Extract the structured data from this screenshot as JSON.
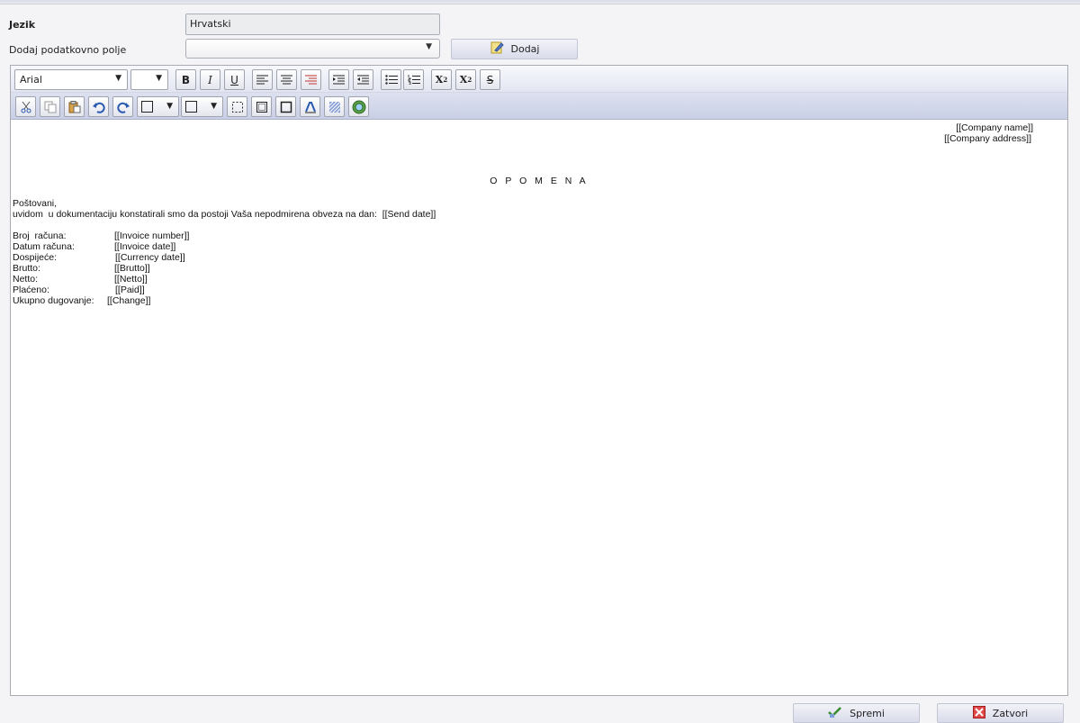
{
  "form": {
    "language_label": "Jezik",
    "language_value": "Hrvatski",
    "add_field_label": "Dodaj podatkovno polje",
    "add_field_selected": "",
    "add_button": "Dodaj"
  },
  "toolbar": {
    "font_family": "Arial",
    "font_size": "",
    "bold": "B",
    "italic": "I",
    "underline": "U"
  },
  "document": {
    "company_name": "[[Company name]]",
    "company_address": "[[Company address]]",
    "title": "O P O M E N A",
    "greeting": "Poštovani,",
    "intro": "uvidom  u dokumentaciju konstatirali smo da postoji Vaša nepodmirena obveza na dan:  [[Send date]]",
    "fields": [
      {
        "label": "Broj  računa:",
        "value": "[[Invoice number]]"
      },
      {
        "label": "Datum računa:",
        "value": "[[Invoice date]]"
      },
      {
        "label": "Dospijeće:",
        "value": "[[Currency date]]"
      },
      {
        "label": "Brutto:",
        "value": "[[Brutto]]"
      },
      {
        "label": "Netto:",
        "value": "[[Netto]]"
      },
      {
        "label": "Plaćeno:",
        "value": "[[Paid]]"
      },
      {
        "label": "Ukupno dugovanje:",
        "value": "[[Change]]"
      }
    ]
  },
  "footer": {
    "save_label": "Spremi",
    "close_label": "Zatvori"
  },
  "colors": {
    "toolbar_accent": "#c9cfe6",
    "button_bg": "#d9dbea",
    "close_icon": "#e04848",
    "save_icon": "#3a8a2e"
  },
  "icons": {
    "add_button": "note-edit-icon",
    "save_button": "save-icon",
    "close_button": "close-icon"
  }
}
